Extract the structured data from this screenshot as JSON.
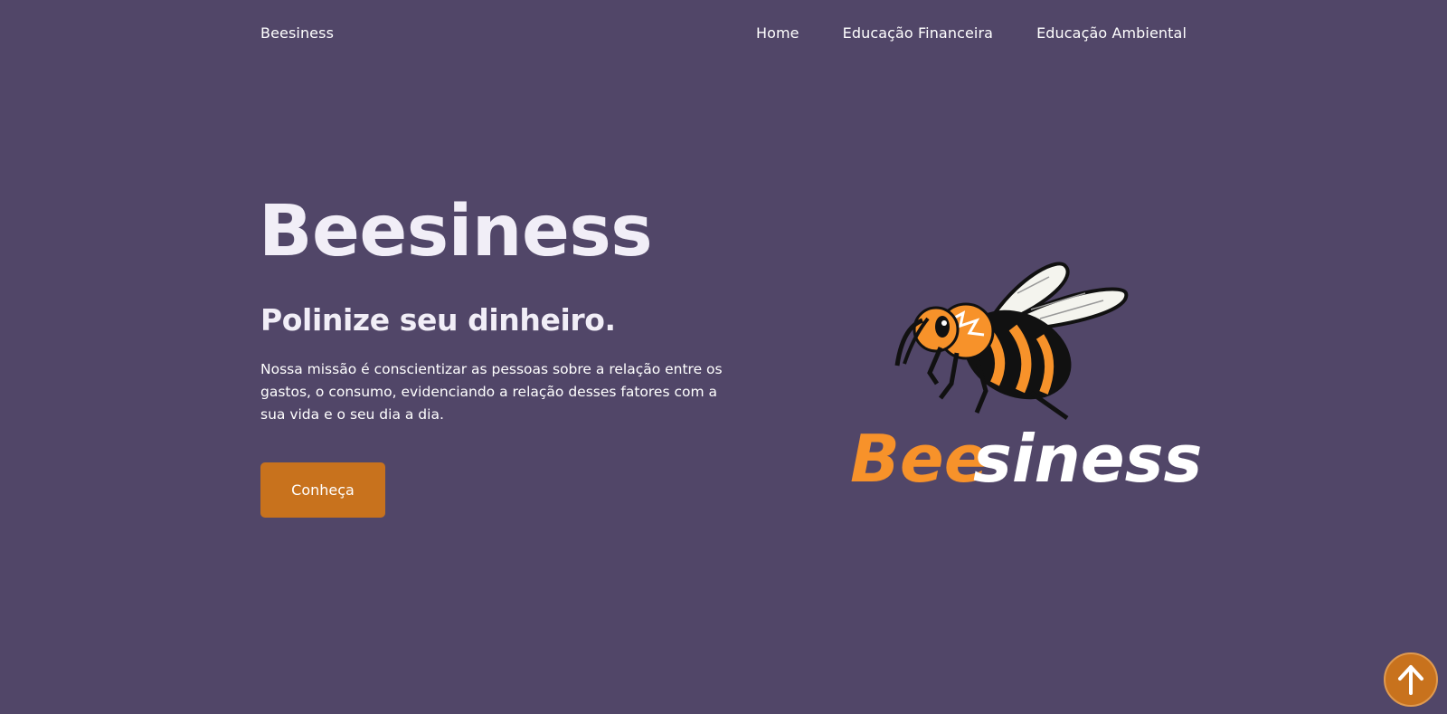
{
  "nav": {
    "brand": "Beesiness",
    "links": [
      "Home",
      "Educação Financeira",
      "Educação Ambiental"
    ]
  },
  "hero": {
    "title": "Beesiness",
    "subtitle": "Polinize seu dinheiro.",
    "text": "Nossa missão é conscientizar as pessoas sobre a relação entre os gastos, o consumo, evidenciando a relação desses fatores com a sua vida e o seu dia a dia.",
    "cta_label": "Conheça"
  },
  "logo": {
    "wordmark_part1": "Bee",
    "wordmark_part2": "siness"
  },
  "icons": {
    "scroll_top": "arrow-up-icon",
    "mascot": "bee-icon"
  },
  "colors": {
    "background": "#514668",
    "accent": "#c8721d",
    "bee_orange": "#f7922a",
    "text": "#ffffff"
  }
}
